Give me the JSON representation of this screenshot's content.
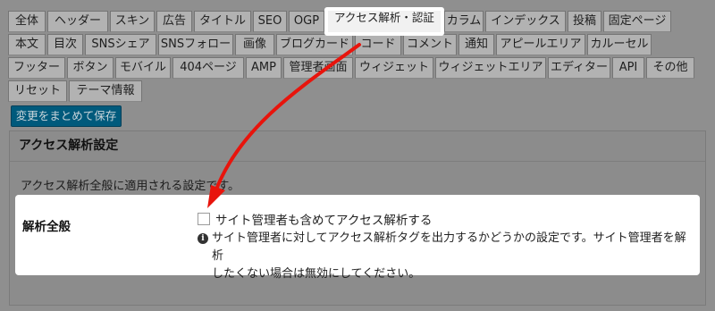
{
  "tabs": {
    "row1": [
      "全体",
      "ヘッダー",
      "スキン",
      "広告",
      "タイトル",
      "SEO",
      "OGP",
      "アクセス解析・認証",
      "カラム",
      "インデックス",
      "投稿",
      "固定ページ"
    ],
    "row2": [
      "本文",
      "目次",
      "SNSシェア",
      "SNSフォロー",
      "画像",
      "ブログカード",
      "コード",
      "コメント",
      "通知",
      "アピールエリア",
      "カルーセル"
    ],
    "row3": [
      "フッター",
      "ボタン",
      "モバイル",
      "404ページ",
      "AMP",
      "管理者画面",
      "ウィジェット",
      "ウィジェットエリア",
      "エディター",
      "API",
      "その他"
    ],
    "row4": [
      "リセット",
      "テーマ情報"
    ],
    "active": "アクセス解析・認証"
  },
  "save_button": "変更をまとめて保存",
  "panel": {
    "title": "アクセス解析設定",
    "description": "アクセス解析全般に適用される設定です。"
  },
  "setting": {
    "label": "解析全般",
    "checkbox_label": "サイト管理者も含めてアクセス解析する",
    "checked": false,
    "info_icon": "info-circle-icon",
    "help_line1": "サイト管理者に対してアクセス解析タグを出力するかどうかの設定です。サイト管理者を解析",
    "help_line2": "したくない場合は無効にしてください。"
  },
  "colors": {
    "overlay": "#8f8f8f",
    "button": "#005a7c",
    "arrow": "#e8140c",
    "highlight": "#ffffff"
  }
}
